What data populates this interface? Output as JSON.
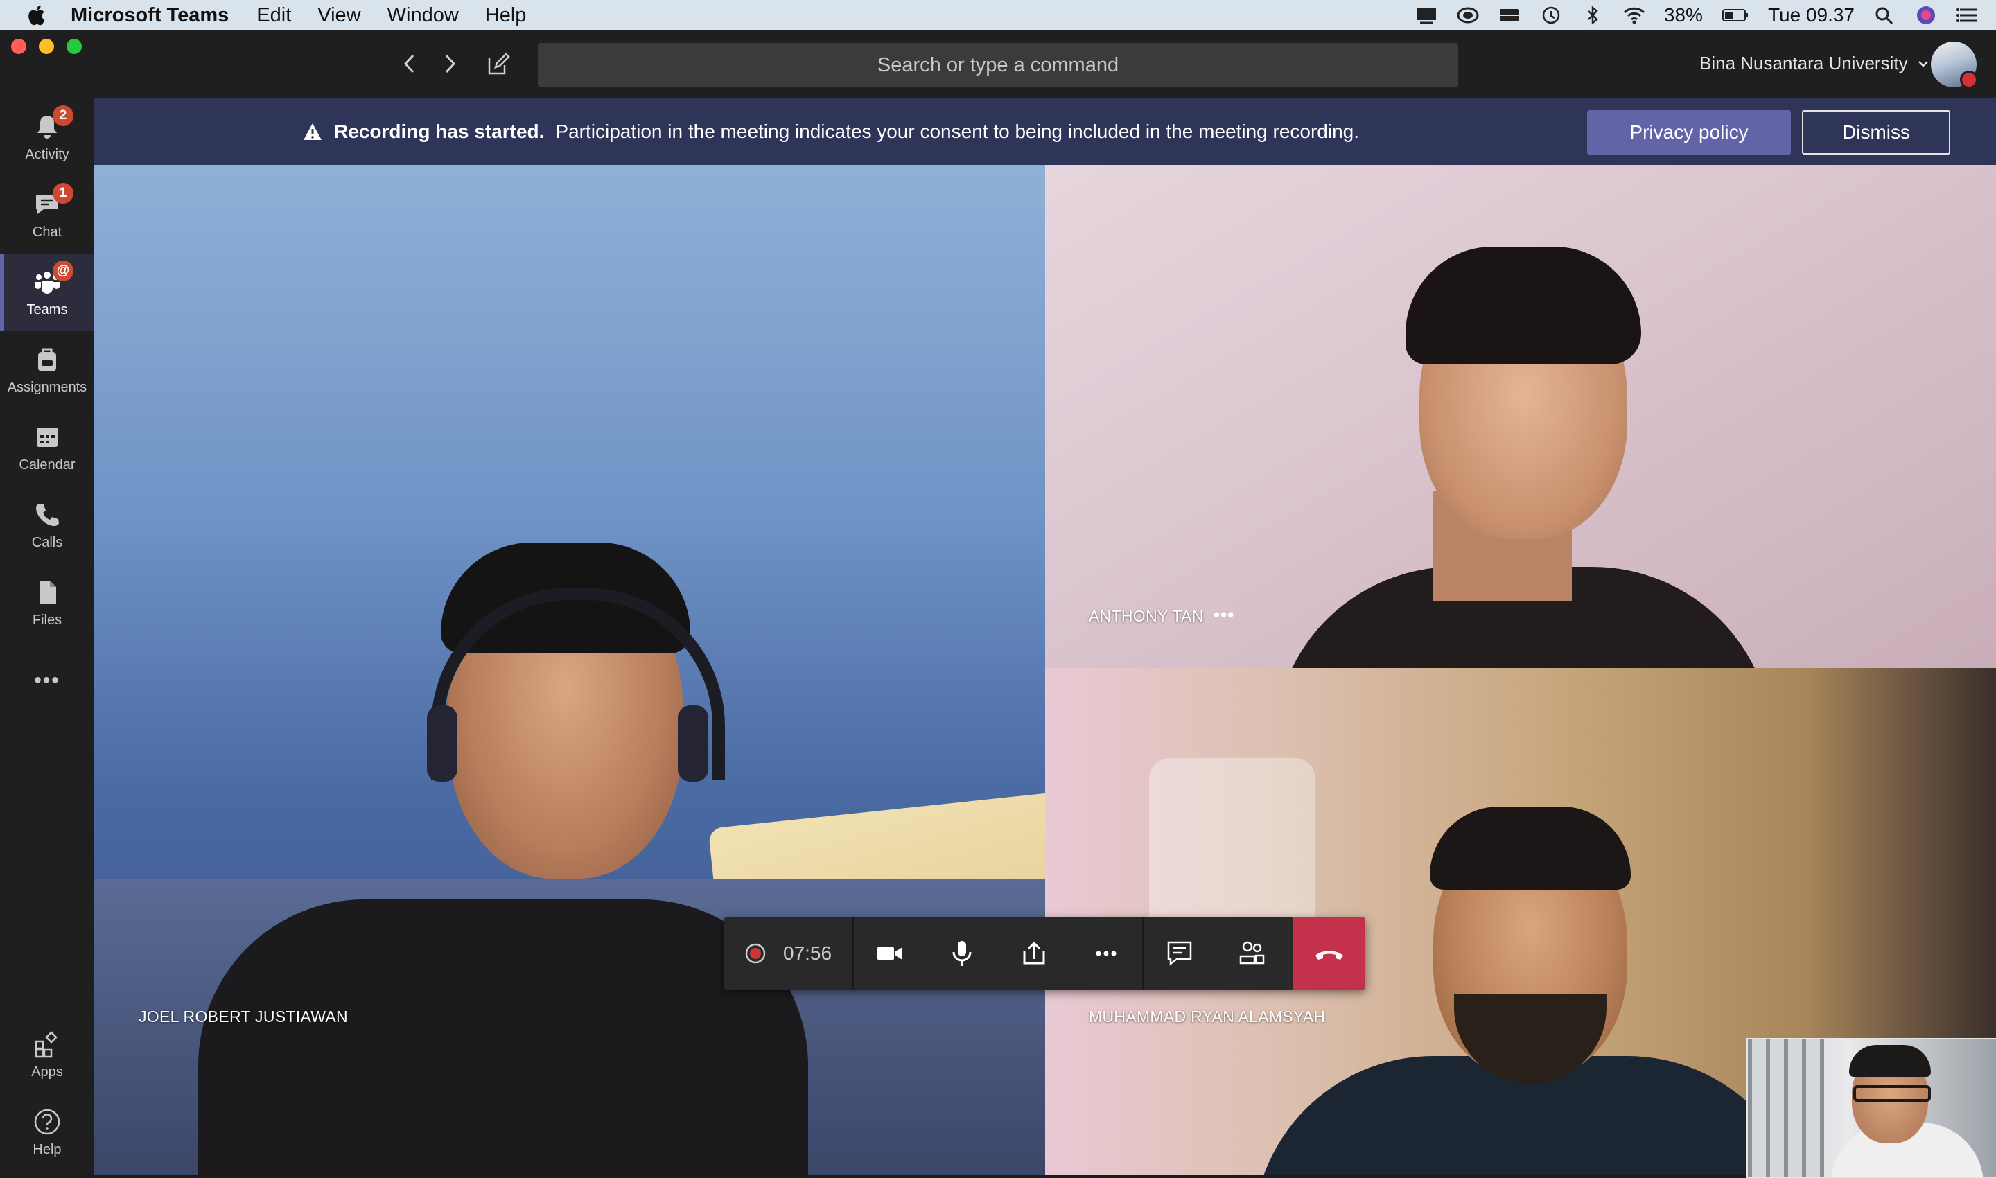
{
  "menubar": {
    "app_name": "Microsoft Teams",
    "menus": [
      "Edit",
      "View",
      "Window",
      "Help"
    ],
    "battery": "38%",
    "clock": "Tue 09.37"
  },
  "titlebar": {
    "search_placeholder": "Search or type a command",
    "org_name": "Bina Nusantara University"
  },
  "rail": {
    "items": [
      {
        "label": "Activity",
        "icon": "bell-icon",
        "badge": "2"
      },
      {
        "label": "Chat",
        "icon": "chat-icon",
        "badge": "1"
      },
      {
        "label": "Teams",
        "icon": "teams-icon",
        "badge": "@",
        "active": true
      },
      {
        "label": "Assignments",
        "icon": "backpack-icon"
      },
      {
        "label": "Calendar",
        "icon": "calendar-icon"
      },
      {
        "label": "Calls",
        "icon": "phone-icon"
      },
      {
        "label": "Files",
        "icon": "file-icon"
      }
    ],
    "more": "•••",
    "bottom": [
      {
        "label": "Apps",
        "icon": "apps-icon"
      },
      {
        "label": "Help",
        "icon": "help-icon"
      }
    ]
  },
  "banner": {
    "bold": "Recording has started.",
    "text": "Participation in the meeting indicates your consent to being included in the meeting recording.",
    "privacy_label": "Privacy policy",
    "dismiss_label": "Dismiss"
  },
  "participants": [
    {
      "name": "JOEL ROBERT JUSTIAWAN"
    },
    {
      "name": "ANTHONY TAN",
      "more": "•••"
    },
    {
      "name": "MUHAMMAD RYAN ALAMSYAH"
    }
  ],
  "controls": {
    "timer": "07:56"
  },
  "colors": {
    "accent": "#6264a7",
    "banner": "#2f3558",
    "badge": "#cc4a31",
    "hangup": "#c4314b"
  }
}
